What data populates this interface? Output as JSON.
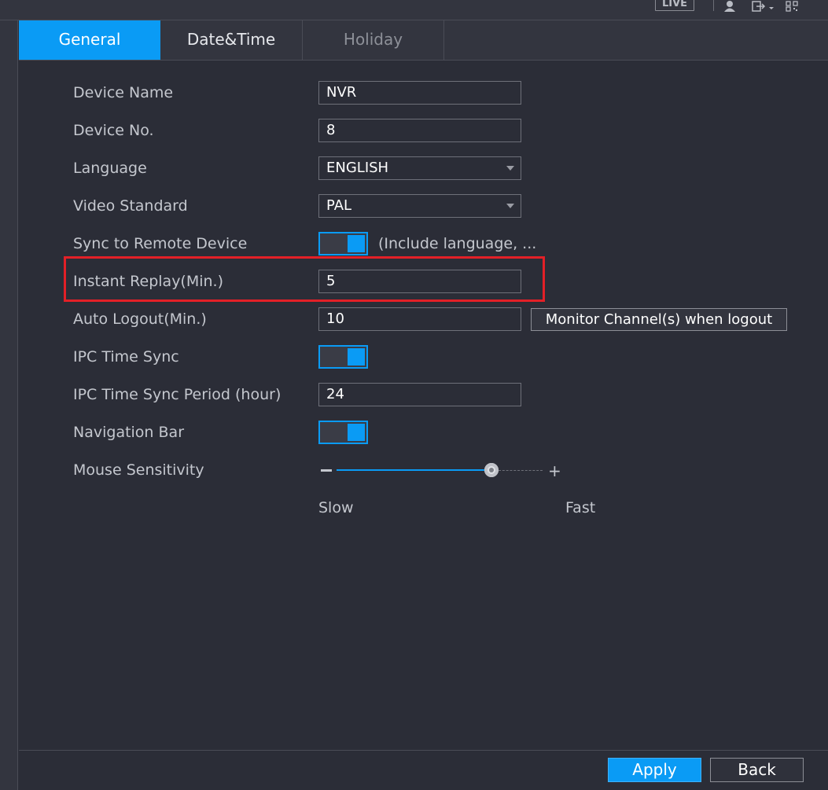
{
  "topbar": {
    "live_label": "LIVE",
    "icons": [
      "user-icon",
      "logout-icon",
      "qr-code-icon"
    ]
  },
  "tabs": [
    {
      "label": "General",
      "active": true
    },
    {
      "label": "Date&Time",
      "active": false
    },
    {
      "label": "Holiday",
      "active": false
    }
  ],
  "form": {
    "device_name": {
      "label": "Device Name",
      "value": "NVR"
    },
    "device_no": {
      "label": "Device No.",
      "value": "8"
    },
    "language": {
      "label": "Language",
      "value": "ENGLISH"
    },
    "video_standard": {
      "label": "Video Standard",
      "value": "PAL"
    },
    "sync_remote": {
      "label": "Sync to Remote Device",
      "enabled": true,
      "note": "(Include language, ..."
    },
    "instant_replay": {
      "label": "Instant Replay(Min.)",
      "value": "5"
    },
    "auto_logout": {
      "label": "Auto Logout(Min.)",
      "value": "10",
      "button_label": "Monitor Channel(s) when logout"
    },
    "ipc_time_sync": {
      "label": "IPC Time Sync",
      "enabled": true
    },
    "ipc_sync_period": {
      "label": "IPC Time Sync Period (hour)",
      "value": "24"
    },
    "navigation_bar": {
      "label": "Navigation Bar",
      "enabled": true
    },
    "mouse_sensitivity": {
      "label": "Mouse Sensitivity",
      "level": 0.75,
      "min_label": "Slow",
      "max_label": "Fast"
    }
  },
  "highlight_color": "#e32027",
  "accent_color": "#0a9bf5",
  "footer": {
    "apply_label": "Apply",
    "back_label": "Back"
  }
}
